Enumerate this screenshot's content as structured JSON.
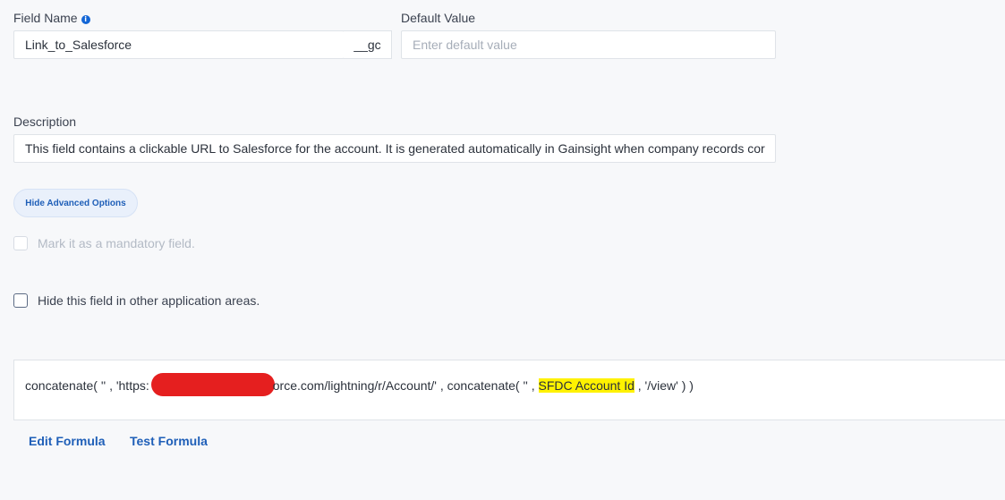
{
  "field_name": {
    "label": "Field Name",
    "info_icon": "info-icon",
    "value": "Link_to_Salesforce",
    "suffix": "__gc"
  },
  "default_value": {
    "label": "Default Value",
    "placeholder": "Enter default value"
  },
  "description": {
    "label": "Description",
    "value": "This field contains a clickable URL to Salesforce for the account. It is generated automatically in Gainsight when company records cor"
  },
  "advanced_toggle": {
    "label": "Hide Advanced Options"
  },
  "options": {
    "mandatory": {
      "label": "Mark it as a mandatory field.",
      "checked": false,
      "disabled": true
    },
    "hide_field": {
      "label": "Hide this field in other application areas.",
      "checked": false,
      "disabled": false
    }
  },
  "formula": {
    "prefix": "concatenate( '' , 'https:",
    "middle": "orce.com/lightning/r/Account/' , concatenate( '' , ",
    "highlight": "SFDC Account Id",
    "suffix": " , '/view' ) )",
    "redaction_color": "#e51f1f",
    "highlight_color": "#fff200"
  },
  "actions": {
    "edit": "Edit Formula",
    "test": "Test Formula"
  },
  "colors": {
    "accent": "#1f5fb8",
    "info": "#1366d6"
  }
}
